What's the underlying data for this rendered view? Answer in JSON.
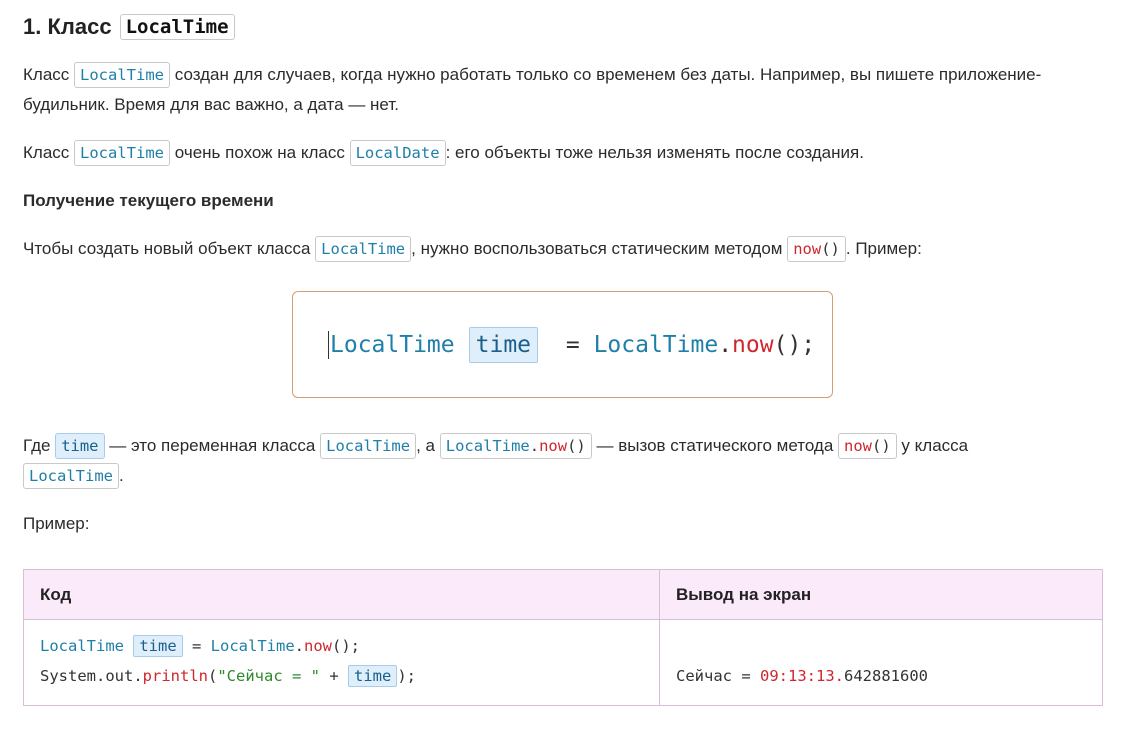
{
  "heading": {
    "prefix": "1. Класс",
    "code": "LocalTime"
  },
  "intro": {
    "word1": "Класс",
    "code1": "LocalTime",
    "text1": "создан для случаев, когда нужно работать только со временем без даты. Например, вы пишете приложение-будильник. Время для вас важно, а дата — нет."
  },
  "similar": {
    "word1": "Класс",
    "code1": "LocalTime",
    "text1": "очень похож на класс",
    "code2": "LocalDate",
    "text2": ": его объекты тоже нельзя изменять после создания."
  },
  "subheading": "Получение текущего времени",
  "howto": {
    "text1": "Чтобы создать новый объект класса",
    "code1": "LocalTime",
    "text2": ", нужно воспользоваться статическим методом",
    "method": "now",
    "parens": "()",
    "text3": ". Пример:"
  },
  "example_box": {
    "cls": "LocalTime",
    "var": "time",
    "eq": " = ",
    "cls2": "LocalTime",
    "dot": ".",
    "method": "now",
    "tail": "();"
  },
  "explain": {
    "text1": "Где",
    "var": "time",
    "text2": "— это переменная класса",
    "code1": "LocalTime",
    "text3": ", а",
    "code2_cls": "LocalTime",
    "code2_dot": ".",
    "code2_method": "now",
    "code2_parens": "()",
    "text4": "— вызов статического метода",
    "method": "now",
    "parens": "()",
    "text5": "у класса",
    "code3": "LocalTime",
    "text6": "."
  },
  "example_label": "Пример:",
  "table": {
    "headers": [
      "Код",
      "Вывод на экран"
    ],
    "code_line1": {
      "cls": "LocalTime",
      "var": "time",
      "eq": " = ",
      "cls2": "LocalTime",
      "dot": ".",
      "method": "now",
      "tail": "();"
    },
    "code_line2": {
      "prefix": "System.out.",
      "method": "println",
      "open": "(",
      "str": "\"Сейчас = \"",
      "plus": " + ",
      "var": "time",
      "tail": ");"
    },
    "output": {
      "label": "Сейчас = ",
      "red_part": "09:13:13.",
      "rest": "642881600"
    }
  },
  "colors": {
    "code_blue": "#1e7fa8",
    "method_red": "#d0262d",
    "string_green": "#2c8a2c",
    "header_bg": "#faeafa",
    "box_border": "#d79e6f"
  }
}
